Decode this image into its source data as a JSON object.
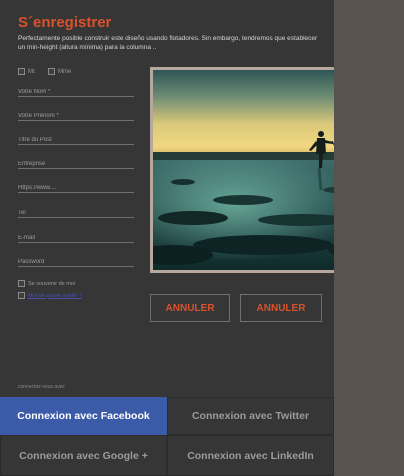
{
  "form": {
    "title": "S´enregistrer",
    "intro": "Perfectamente posible construir este diseño usando flotadores. Sin embargo, tendremos que establecer un min-height (altura mínima) para la columna ..",
    "civility": [
      "Mr.",
      "Mme"
    ],
    "fields": {
      "nom": "Votre Nom *",
      "prenom": "Votre Prénom *",
      "titre": "Titre du Post",
      "entreprise": "Entreprise",
      "website": "Https://www....",
      "tel": "Tel",
      "email": "E-mail",
      "password": "Password"
    },
    "remember_label": "Se souvenir de moi",
    "link_text": "Mot de passe oublié ?",
    "connect_label": "connectez-vous avec"
  },
  "actions": {
    "cancel_1": "ANNULER",
    "cancel_2": "ANNULER"
  },
  "social": {
    "facebook": "Connexion avec Facebook",
    "twitter": "Connexion avec Twitter",
    "google": "Connexion avec Google +",
    "linkedin": "Connexion avec LinkedIn"
  },
  "colors": {
    "accent": "#d9522c",
    "facebook_active": "#3b5ba8",
    "panel": "#363636"
  }
}
